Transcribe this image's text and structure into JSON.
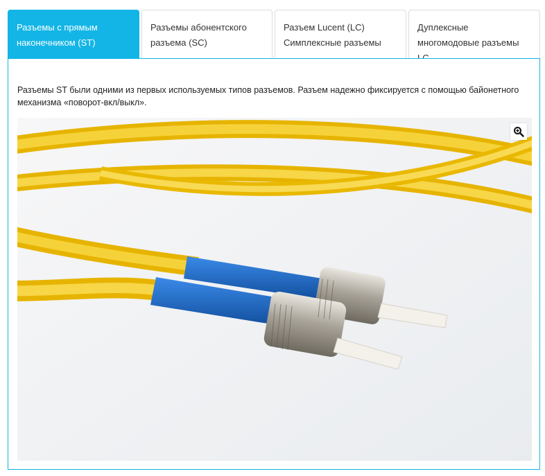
{
  "tabs": [
    {
      "label": "Разъемы с прямым наконечником (ST)",
      "active": true
    },
    {
      "label": "Разъемы абонентского разъема (SC)",
      "active": false
    },
    {
      "label": "Разъем Lucent (LC) Симплексные разъемы",
      "active": false
    },
    {
      "label": "Дуплексные многомодовые разъемы LC",
      "active": false
    }
  ],
  "panel": {
    "description": "Разъемы ST были одними из первых используемых типов разъемов. Разъем надежно фиксируется с помощью байонетного механизма «поворот-вкл/выкл».",
    "image_subject": "fiber-optic-st-connectors",
    "zoom_icon": "zoom-in-icon"
  },
  "colors": {
    "accent": "#13b5e6",
    "cable": "#f2c51a",
    "boot": "#1f6fd0",
    "metal": "#b8b3a8"
  }
}
